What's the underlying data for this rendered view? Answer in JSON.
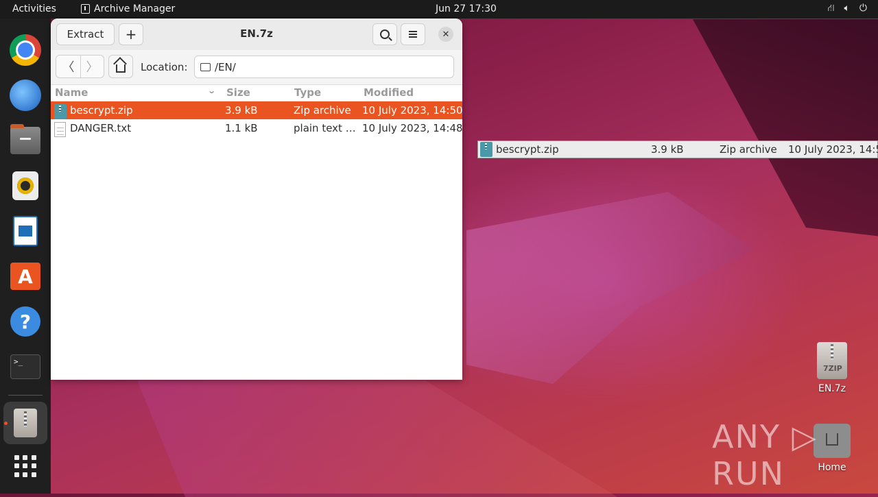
{
  "topbar": {
    "activities": "Activities",
    "app_name": "Archive Manager",
    "clock": "Jun 27  17:30",
    "tray_icons": [
      "network-icon",
      "volume-icon",
      "power-icon"
    ]
  },
  "dock": {
    "items": [
      "chrome-icon",
      "thunderbird-icon",
      "files-icon",
      "rhythmbox-icon",
      "writer-icon",
      "app-center-icon",
      "help-icon",
      "terminal-icon",
      "archive-manager-icon"
    ],
    "active": "archive-manager-icon"
  },
  "window": {
    "title": "EN.7z",
    "extract_label": "Extract",
    "add_label": "+",
    "close_label": "✕",
    "location_label": "Location:",
    "location_value": "/EN/",
    "columns": {
      "name": "Name",
      "size": "Size",
      "type": "Type",
      "modified": "Modified"
    },
    "files": [
      {
        "name": "bescrypt.zip",
        "size": "3.9 kB",
        "type": "Zip archive",
        "modified": "10 July 2023, 14:50",
        "selected": true
      },
      {
        "name": "DANGER.txt",
        "size": "1.1 kB",
        "type": "plain text …",
        "modified": "10 July 2023, 14:48",
        "selected": false
      }
    ]
  },
  "drag_row": {
    "name": "bescrypt.zip",
    "size": "3.9 kB",
    "type": "Zip archive",
    "modified": "10 July 2023, 14:5"
  },
  "desktop": {
    "icons": [
      {
        "label": "EN.7z"
      },
      {
        "label": "Home"
      }
    ]
  },
  "watermark": "ANY ▷ RUN",
  "colors": {
    "accent": "#e95420",
    "topbar": "#1b1b1b",
    "dock": "#1f1f1f"
  }
}
